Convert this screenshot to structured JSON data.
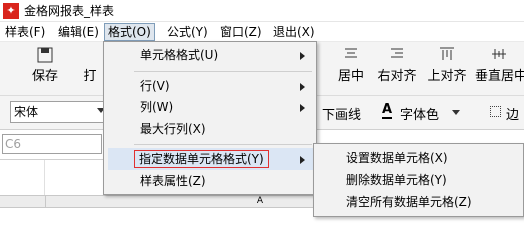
{
  "window": {
    "title": "金格网报表_样表"
  },
  "menubar": {
    "items": [
      {
        "label": "样表(F)"
      },
      {
        "label": "编辑(E)"
      },
      {
        "label": "格式(O)"
      },
      {
        "label": "公式(Y)"
      },
      {
        "label": "窗口(Z)"
      },
      {
        "label": "退出(X)"
      }
    ]
  },
  "toolbar1": {
    "save": "保存",
    "partial": "打",
    "center": "居中",
    "right_align": "右对齐",
    "top_align": "上对齐",
    "vcenter": "垂直居中"
  },
  "toolbar2": {
    "font": "宋体",
    "underline": "下画线",
    "font_color": "字体色",
    "border": "边"
  },
  "namebox": {
    "value": "C6"
  },
  "grid": {
    "col_a": "A"
  },
  "format_menu": {
    "cell_format": "单元格格式(U)",
    "row": "行(V)",
    "col": "列(W)",
    "max_rowcol": "最大行列(X)",
    "assign_data_cell": "指定数据单元格格式(Y)",
    "sheet_props": "样表属性(Z)"
  },
  "submenu": {
    "set_data_cell": "设置数据单元格(X)",
    "delete_data_cell": "删除数据单元格(Y)",
    "clear_all": "清空所有数据单元格(Z)"
  },
  "colors": {
    "accent_red": "#d9241c",
    "highlight": "#dbe6f4",
    "menu_bg": "#f2f2f2"
  }
}
